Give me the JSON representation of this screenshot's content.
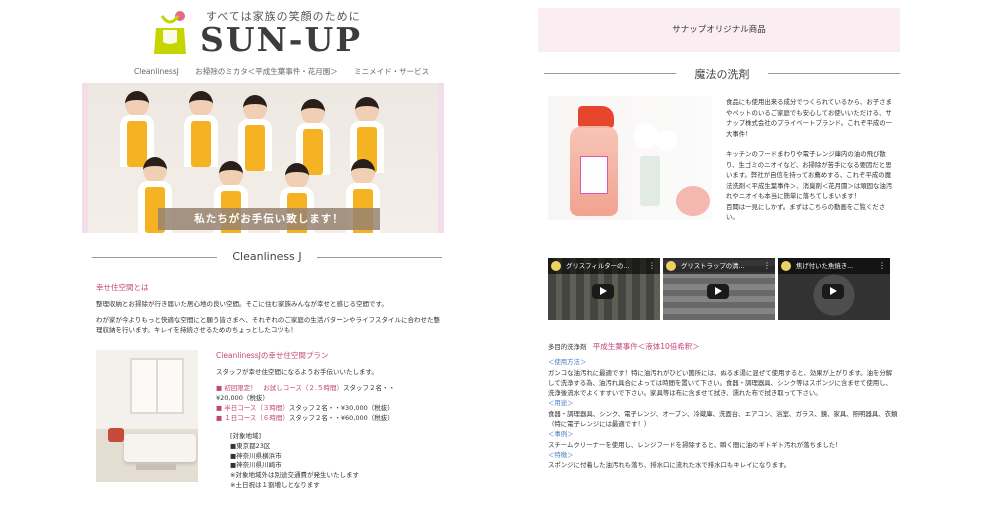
{
  "left": {
    "tagline": "すべては家族の笑顔のために",
    "brand": "SUN-UP",
    "nav": [
      "CleanlinessJ",
      "お掃除のミカタ＜平成生葉事件・花月園＞",
      "ミニメイド・サービス"
    ],
    "hero_caption": "私たちがお手伝い致します！",
    "section_title": "Cleanliness J",
    "intro": {
      "heading": "幸せ住空間とは",
      "p1": "整理収納とお掃除が行き届いた居心地の良い空間。そこに住む家族みんなが幸せと感じる空間です。",
      "p2": "わが家が今よりもっと快適な空間にと願う皆さまへ、それぞれのご家庭の生活パターンやライフスタイルに合わせた整理収納を行います。キレイを持続させるためのちょっとしたコツも！"
    },
    "plan": {
      "heading": "CleanlinessJの幸せ住空間プラン",
      "sub": "スタッフが幸せ住空間になるようお手伝いいたします。",
      "items": [
        {
          "pink": "■ 初回限定！　お試しコース（２.５時間）",
          "rest": "スタッフ２名・・"
        },
        {
          "pink": "",
          "rest": "¥20,000（税抜）"
        },
        {
          "pink": "■ 半日コース（３時間）",
          "rest": "スタッフ２名・・¥30,000（税抜）"
        },
        {
          "pink": "■ １日コース（６時間）",
          "rest": "スタッフ２名・・¥60,000（税抜）"
        }
      ]
    },
    "area": [
      "[対象地域]",
      "■東京都23区",
      "■神奈川県横浜市",
      "■神奈川県川崎市",
      "※対象地域外は別途交通費が発生いたします",
      "※土日祝は１割増しとなります"
    ]
  },
  "right": {
    "banner": "サナップオリジナル商品",
    "section_title": "魔法の洗剤",
    "desc_p1": "食品にも使用出来る成分でつくられているから、お子さまやペットのいるご家庭でも安心してお使いいただける、サナップ株式会社のプライベートブランド。これぞ平成の一大事件！",
    "desc_p2": "キッチンのフードまわりや電子レンジ庫内の油の飛び散り、生ゴミのニオイなど、お掃除が苦手になる要因だと思います。弊社が自信を持ってお薦めする、これぞ平成の魔法洗剤＜平成生葉事件＞、消臭剤＜花月園＞は頑固な油汚れやニオイも本当に簡単に落ちてしまいます！",
    "desc_p3": "百聞は一見にしかず。まずはこちらの動画をご覧ください。",
    "videos": [
      "グリスフィルターの...",
      "グリストラップの清...",
      "焦げ付いた魚焼き..."
    ],
    "product_label": "多目的洗浄剤",
    "product_name": "平成生葉事件＜液体10倍希釈＞",
    "usage_h": "＜使用方法＞",
    "usage": "ガンコな油汚れに最適です！特に油汚れがひどい箇所には、ぬるま湯に混ぜて使用すると、効果が上がります。油を分解して洗浄する為、油汚れ具合によっては時間を置いて下さい。食器・調理器具、シンク等はスポンジに含ませて使用し、洗浄後流水でよくすすいで下さい。家具等は布に含ませて拭き、濡れた布で拭き取って下さい。",
    "use_h": "＜用途＞",
    "use": "食器・調理器具、シンク、電子レンジ、オーブン、冷蔵庫、洗面台、エアコン、浴室、ガラス、鏡、家具、照明器具、衣類（特に電子レンジには最適です！）",
    "example_h": "＜事例＞",
    "example": "スチームクリーナーを使用し、レンジフードを掃除すると、瞬く間に油のギトギト汚れが落ちました！",
    "feature_h": "＜特徴＞",
    "feature": "スポンジに付着した油汚れも落ち、排水口に流れた水で排水口もキレイになります。"
  }
}
